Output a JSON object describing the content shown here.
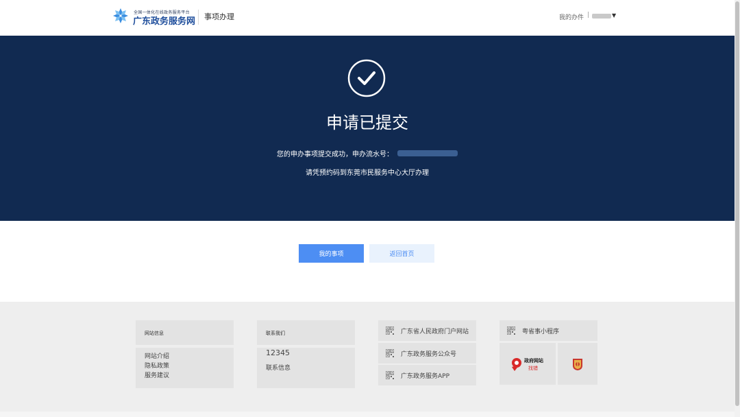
{
  "header": {
    "logo_small": "全国一体化在线政务服务平台",
    "logo_main": "广东政务服务网",
    "section_title": "事项办理",
    "my_items": "我的办件",
    "separator": "|",
    "user_name": ""
  },
  "banner": {
    "title": "申请已提交",
    "message": "您的申办事项提交成功，申办流水号：",
    "serial_number": "",
    "instruction": "请凭预约码到东莞市民服务中心大厅办理"
  },
  "actions": {
    "my_items_button": "我的事项",
    "back_home_button": "返回首页"
  },
  "footer": {
    "site_info": {
      "title": "网站信息",
      "links": [
        "网站介绍",
        "隐私政策",
        "服务建议"
      ]
    },
    "contact": {
      "title": "联系我们",
      "hotline": "12345",
      "info_link": "联系信息"
    },
    "portals": [
      {
        "label": "广东省人民政府门户网站",
        "icon": "qr-code-icon"
      },
      {
        "label": "广东政务服务公众号",
        "icon": "qr-code-icon"
      },
      {
        "label": "广东政务服务APP",
        "icon": "qr-code-icon"
      }
    ],
    "mini_program": {
      "label": "粤省事小程序",
      "badge_title": "政府网站",
      "badge_sub": "找错"
    }
  },
  "colors": {
    "banner_bg": "#112a51",
    "primary": "#4d8ef3",
    "secondary_bg": "#e9f2fd",
    "footer_bg": "#eeeeee",
    "card_bg": "#e3e3e3"
  }
}
